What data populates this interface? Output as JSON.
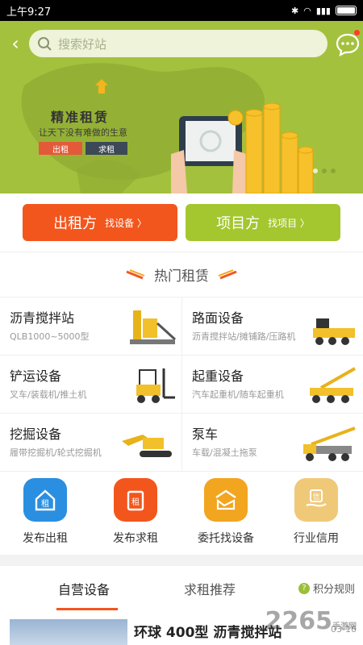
{
  "status_bar": {
    "time": "上午9:27"
  },
  "search": {
    "placeholder": "搜索好站"
  },
  "banner": {
    "title": "精准租赁",
    "subtitle": "让天下没有难做的生意",
    "tag_rent": "出租",
    "tag_seek": "求租"
  },
  "roles": [
    {
      "label": "出租方",
      "sub": "找设备 〉"
    },
    {
      "label": "项目方",
      "sub": "找项目 〉"
    }
  ],
  "hot": {
    "title": "热门租赁"
  },
  "categories": [
    {
      "title": "沥青搅拌站",
      "sub": "QLB1000~5000型"
    },
    {
      "title": "路面设备",
      "sub": "沥青搅拌站/摊铺路/压路机"
    },
    {
      "title": "铲运设备",
      "sub": "叉车/装载机/推土机"
    },
    {
      "title": "起重设备",
      "sub": "汽车起重机/随车起重机"
    },
    {
      "title": "挖掘设备",
      "sub": "履带挖掘机/轮式挖掘机"
    },
    {
      "title": "泵车",
      "sub": "车载/混凝土拖泵"
    }
  ],
  "actions": [
    {
      "label": "发布出租",
      "glyph": "租",
      "color": "#2a8fe0"
    },
    {
      "label": "发布求租",
      "glyph": "租",
      "color": "#f3561d"
    },
    {
      "label": "委托找设备",
      "glyph": "委",
      "color": "#f2a51f"
    },
    {
      "label": "行业信用",
      "glyph": "信",
      "color": "#f0c978"
    }
  ],
  "tabs": {
    "tab1": "自营设备",
    "tab2": "求租推荐",
    "rules": "积分规则"
  },
  "list": {
    "title": "环球 400型 沥青搅拌站",
    "date": "03-16"
  },
  "watermark": {
    "brand": "2265",
    "sub": "手游网"
  },
  "colors": {
    "primary_orange": "#f3561d",
    "primary_green": "#a4c72f",
    "banner_green": "#a4c13e"
  }
}
